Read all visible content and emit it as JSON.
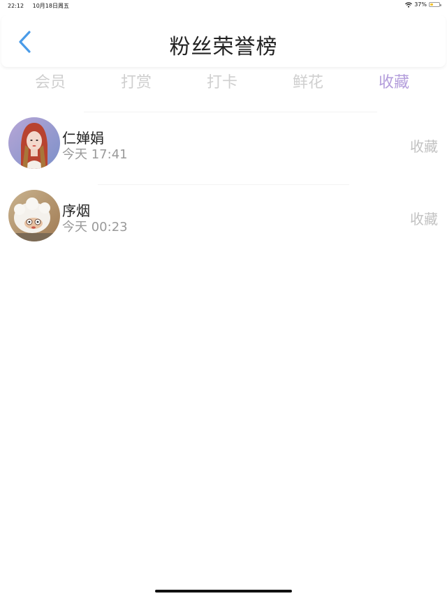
{
  "status_bar": {
    "time": "22:12",
    "date": "10月18日周五",
    "battery": "37%",
    "battery_level": 0.37
  },
  "header": {
    "title": "粉丝荣誉榜",
    "back_icon": "chevron-left-icon"
  },
  "tabs": [
    {
      "label": "会员",
      "active": false
    },
    {
      "label": "打赏",
      "active": false
    },
    {
      "label": "打卡",
      "active": false
    },
    {
      "label": "鲜花",
      "active": false
    },
    {
      "label": "收藏",
      "active": true
    }
  ],
  "list": [
    {
      "name": "仁婵娟",
      "time": "今天 17:41",
      "action": "收藏"
    },
    {
      "name": "序烟",
      "time": "今天 00:23",
      "action": "收藏"
    }
  ],
  "colors": {
    "accent": "#b39ddb",
    "back_arrow": "#4a9be8",
    "tab_inactive": "#cfcfcf"
  }
}
